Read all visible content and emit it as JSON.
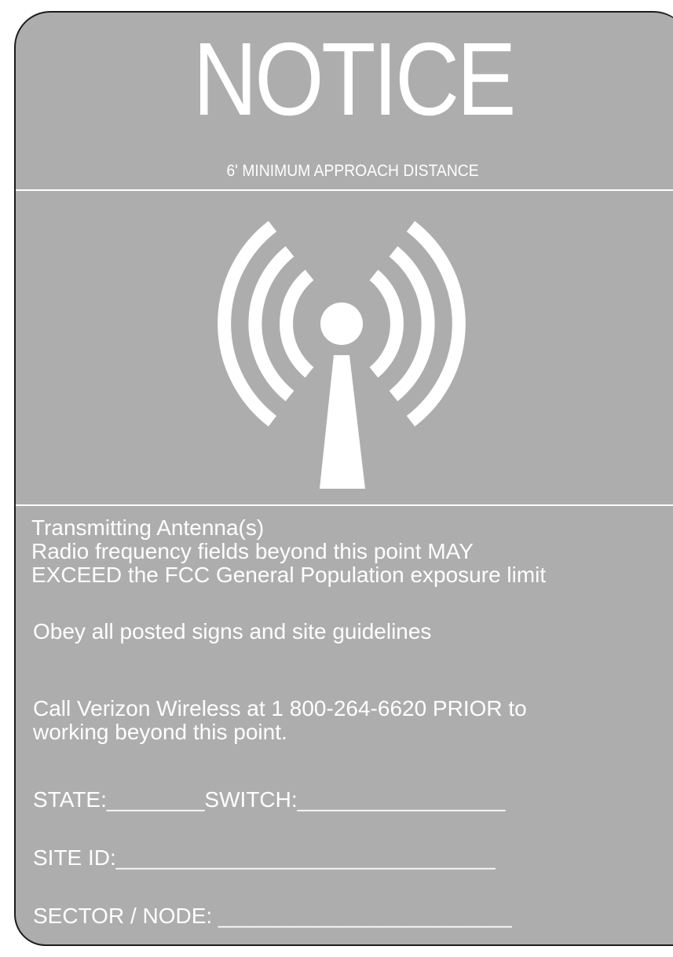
{
  "sign": {
    "title": "NOTICE",
    "subtitle": "6' MINIMUM APPROACH DISTANCE",
    "icon": "radio-antenna-icon",
    "colors": {
      "background": "#adadad",
      "foreground": "#ffffff",
      "border": "#1c1c1c"
    },
    "lines": {
      "transmitting": "Transmitting Antenna(s)",
      "rf_line1": "Radio frequency fields beyond this point MAY",
      "rf_line2": "EXCEED the FCC General Population exposure limit",
      "obey": "Obey all posted signs and site guidelines",
      "call_line1": "Call Verizon Wireless at 1 800-264-6620 PRIOR to",
      "call_line2": "working beyond this point.",
      "state_switch": "STATE:________SWITCH:_________________",
      "site_id": "SITE ID:_______________________________",
      "sector_node": "SECTOR / NODE: ________________________"
    }
  }
}
